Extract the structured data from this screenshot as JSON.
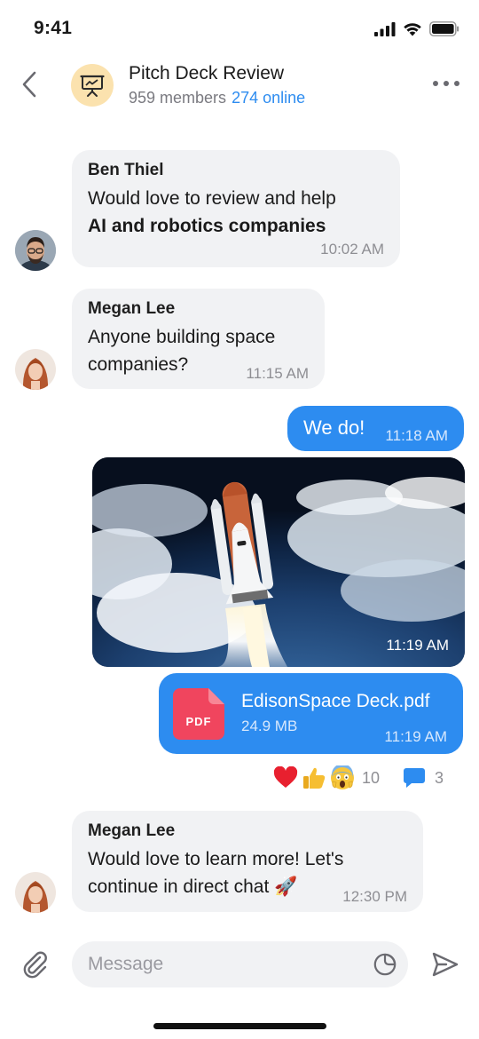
{
  "status": {
    "time": "9:41"
  },
  "header": {
    "title": "Pitch Deck Review",
    "members": "959 members",
    "online": "274 online"
  },
  "messages": [
    {
      "sender": "Ben Thiel",
      "line1": "Would love to review and help",
      "line2": "AI and robotics companies",
      "time": "10:02 AM"
    },
    {
      "sender": "Megan Lee",
      "line1": "Anyone building space",
      "line2": "companies?",
      "time": "11:15 AM"
    },
    {
      "text": "We do!",
      "time": "11:18 AM"
    },
    {
      "image_time": "11:19 AM"
    },
    {
      "file_name": "EdisonSpace Deck.pdf",
      "file_size": "24.9 MB",
      "file_badge": "PDF",
      "time": "11:19 AM"
    },
    {
      "sender": "Megan Lee",
      "line1": "Would love to learn more! Let's",
      "line2": "continue in direct chat 🚀",
      "time": "12:30 PM"
    }
  ],
  "reactions": {
    "icons": [
      "heart-icon",
      "thumbs-up-icon",
      "screaming-face-icon"
    ],
    "count": "10",
    "comments": "3"
  },
  "composer": {
    "placeholder": "Message"
  },
  "colors": {
    "accent": "#2d8cf0",
    "bubble_in": "#f1f2f4",
    "pdf": "#f0455e"
  }
}
